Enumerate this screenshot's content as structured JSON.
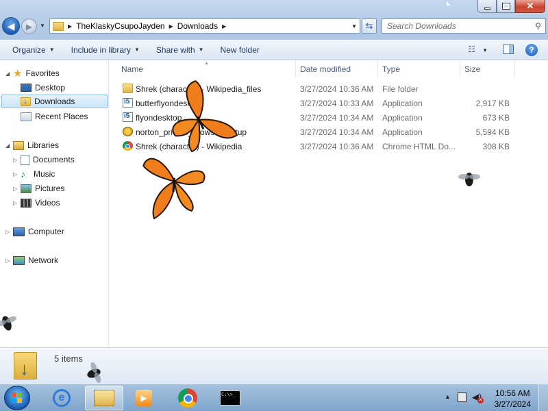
{
  "window": {
    "breadcrumb": [
      "TheKlaskyCsupoJayden",
      "Downloads"
    ],
    "search_placeholder": "Search Downloads"
  },
  "commands": {
    "organize": "Organize",
    "include_in_library": "Include in library",
    "share_with": "Share with",
    "new_folder": "New folder"
  },
  "sidebar": {
    "favorites": "Favorites",
    "desktop": "Desktop",
    "downloads": "Downloads",
    "recent_places": "Recent Places",
    "libraries": "Libraries",
    "documents": "Documents",
    "music": "Music",
    "pictures": "Pictures",
    "videos": "Videos",
    "computer": "Computer",
    "network": "Network"
  },
  "columns": {
    "name": "Name",
    "date_modified": "Date modified",
    "type": "Type",
    "size": "Size"
  },
  "files": [
    {
      "name": "Shrek (character) - Wikipedia_files",
      "date": "3/27/2024 10:36 AM",
      "type": "File folder",
      "size": "",
      "icon": "folder-icon"
    },
    {
      "name": "butterflyondesktop",
      "date": "3/27/2024 10:33 AM",
      "type": "Application",
      "size": "2,917 KB",
      "icon": "installer-icon"
    },
    {
      "name": "flyondesktop",
      "date": "3/27/2024 10:34 AM",
      "type": "Application",
      "size": "673 KB",
      "icon": "installer-icon"
    },
    {
      "name": "norton_private_browser_setup",
      "date": "3/27/2024 10:34 AM",
      "type": "Application",
      "size": "5,594 KB",
      "icon": "norton-icon"
    },
    {
      "name": "Shrek (character) - Wikipedia",
      "date": "3/27/2024 10:36 AM",
      "type": "Chrome HTML Do...",
      "size": "308 KB",
      "icon": "chrome-icon"
    }
  ],
  "details": {
    "item_count": "5 items"
  },
  "taskbar": {
    "time": "10:56 AM",
    "date": "3/27/2024"
  }
}
